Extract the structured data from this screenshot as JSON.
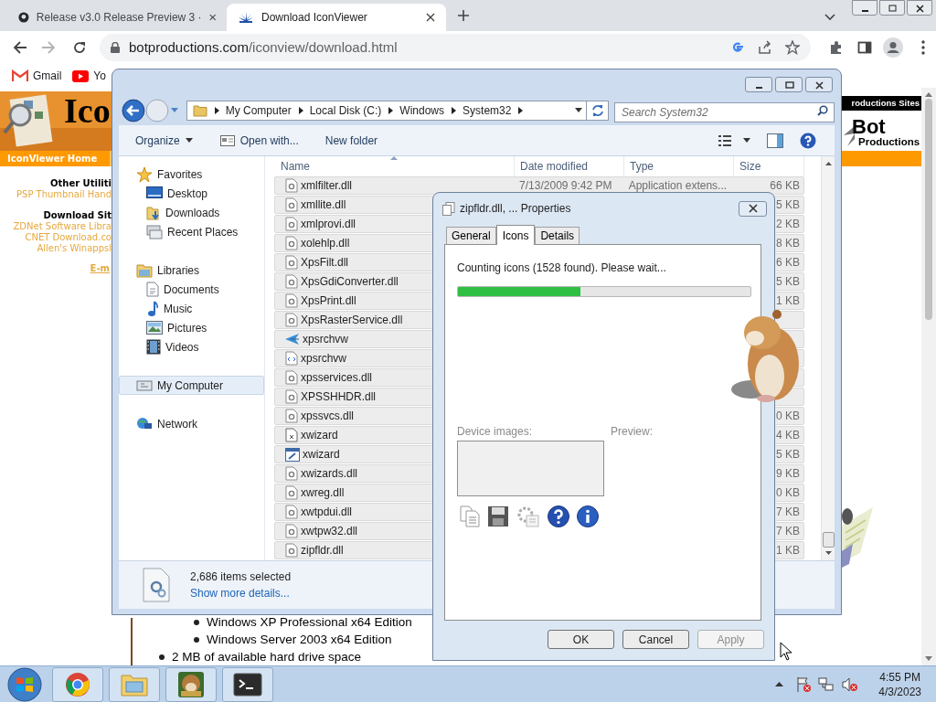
{
  "browser": {
    "tabs": [
      {
        "title": "Release v3.0 Release Preview 3 ·",
        "selected": false
      },
      {
        "title": "Download IconViewer",
        "selected": true
      }
    ],
    "address": {
      "host": "botproductions.com",
      "path": "/iconview/download.html"
    },
    "bookmarks": [
      {
        "label": "Gmail"
      },
      {
        "label": "Yo"
      }
    ]
  },
  "web_page": {
    "logo_text": "Ico",
    "nav_link": "IconViewer Home",
    "sidebar": [
      {
        "kind": "heading",
        "text": "Other Utiliti"
      },
      {
        "kind": "link",
        "text": "PSP Thumbnail Hand"
      },
      {
        "kind": "heading",
        "text": "Download Sit"
      },
      {
        "kind": "link",
        "text": "ZDNet Software Libra"
      },
      {
        "kind": "link",
        "text": "CNET Download.co"
      },
      {
        "kind": "link",
        "text": "Allen's Winappsl"
      },
      {
        "kind": "email",
        "text": "E-m"
      }
    ],
    "sites_header": "roductions Sites",
    "brand_name": "Bot",
    "brand_sub": "Productions",
    "requirements": [
      {
        "children": [
          {
            "text": "Windows XP Professional x64 Edition"
          },
          {
            "text": "Windows Server 2003 x64 Edition"
          }
        ]
      },
      {
        "text": "2 MB of available hard drive space"
      }
    ]
  },
  "explorer": {
    "breadcrumb": [
      "My Computer",
      "Local Disk (C:)",
      "Windows",
      "System32"
    ],
    "search": {
      "placeholder": "Search System32"
    },
    "toolbar": [
      "Organize",
      "Open with...",
      "New folder"
    ],
    "nav": [
      {
        "label": "Favorites",
        "selected": false,
        "children": [
          {
            "label": "Desktop",
            "selected": false
          },
          {
            "label": "Downloads",
            "selected": false
          },
          {
            "label": "Recent Places",
            "selected": false
          }
        ]
      },
      {
        "label": "Libraries",
        "selected": false,
        "children": [
          {
            "label": "Documents",
            "selected": false
          },
          {
            "label": "Music",
            "selected": false
          },
          {
            "label": "Pictures",
            "selected": false
          },
          {
            "label": "Videos",
            "selected": false
          }
        ]
      },
      {
        "label": "My Computer",
        "selected": true
      },
      {
        "label": "Network",
        "selected": false
      }
    ],
    "columns": [
      "Name",
      "Date modified",
      "Type",
      "Size"
    ],
    "rows": [
      {
        "name": "xmlfilter.dll",
        "kind": "dll",
        "date": "7/13/2009 9:42 PM",
        "type": "Application extens...",
        "size": "66 KB",
        "selected": true
      },
      {
        "name": "xmllite.dll",
        "kind": "dll",
        "size": "5 KB",
        "selected": true
      },
      {
        "name": "xmlprovi.dll",
        "kind": "dll",
        "size": "2 KB",
        "selected": true
      },
      {
        "name": "xolehlp.dll",
        "kind": "dll",
        "size": "8 KB",
        "selected": true
      },
      {
        "name": "XpsFilt.dll",
        "kind": "dll",
        "size": "6 KB",
        "selected": true
      },
      {
        "name": "XpsGdiConverter.dll",
        "kind": "dll",
        "size": "5 KB",
        "selected": true
      },
      {
        "name": "XpsPrint.dll",
        "kind": "dll",
        "size": "1 KB",
        "selected": true
      },
      {
        "name": "XpsRasterService.dll",
        "kind": "dll",
        "selected": true
      },
      {
        "name": "xpsrchvw",
        "kind": "app",
        "selected": true
      },
      {
        "name": "xpsrchvw",
        "kind": "xml",
        "selected": true
      },
      {
        "name": "xpsservices.dll",
        "kind": "dll",
        "selected": true
      },
      {
        "name": "XPSSHHDR.dll",
        "kind": "dll",
        "selected": true
      },
      {
        "name": "xpssvcs.dll",
        "kind": "dll",
        "size": "0 KB",
        "selected": true
      },
      {
        "name": "xwizard",
        "kind": "inf",
        "size": "4 KB",
        "selected": true
      },
      {
        "name": "xwizard",
        "kind": "exe",
        "size": "5 KB",
        "selected": true
      },
      {
        "name": "xwizards.dll",
        "kind": "dll",
        "size": "9 KB",
        "selected": true
      },
      {
        "name": "xwreg.dll",
        "kind": "dll",
        "size": "0 KB",
        "selected": true
      },
      {
        "name": "xwtpdui.dll",
        "kind": "dll",
        "size": "7 KB",
        "selected": true
      },
      {
        "name": "xwtpw32.dll",
        "kind": "dll",
        "size": "7 KB",
        "selected": true
      },
      {
        "name": "zipfldr.dll",
        "kind": "dll",
        "size": "1 KB",
        "selected": true
      }
    ],
    "status": {
      "text": "2,686 items selected",
      "link": "Show more details..."
    }
  },
  "dialog": {
    "title": "zipfldr.dll, ... Properties",
    "tabs": [
      {
        "label": "General",
        "selected": false
      },
      {
        "label": "Icons",
        "selected": true
      },
      {
        "label": "Details",
        "selected": false
      }
    ],
    "status_text": "Counting icons (1528 found). Please wait...",
    "progress": {
      "level": 0.42
    },
    "device_images_label": "Device images:",
    "preview_label": "Preview:",
    "buttons": [
      {
        "label": "OK",
        "disabled": false
      },
      {
        "label": "Cancel",
        "disabled": false
      },
      {
        "label": "Apply",
        "disabled": true
      }
    ]
  },
  "taskbar": {
    "clock": {
      "time": "4:55 PM",
      "date": "4/3/2023"
    }
  }
}
